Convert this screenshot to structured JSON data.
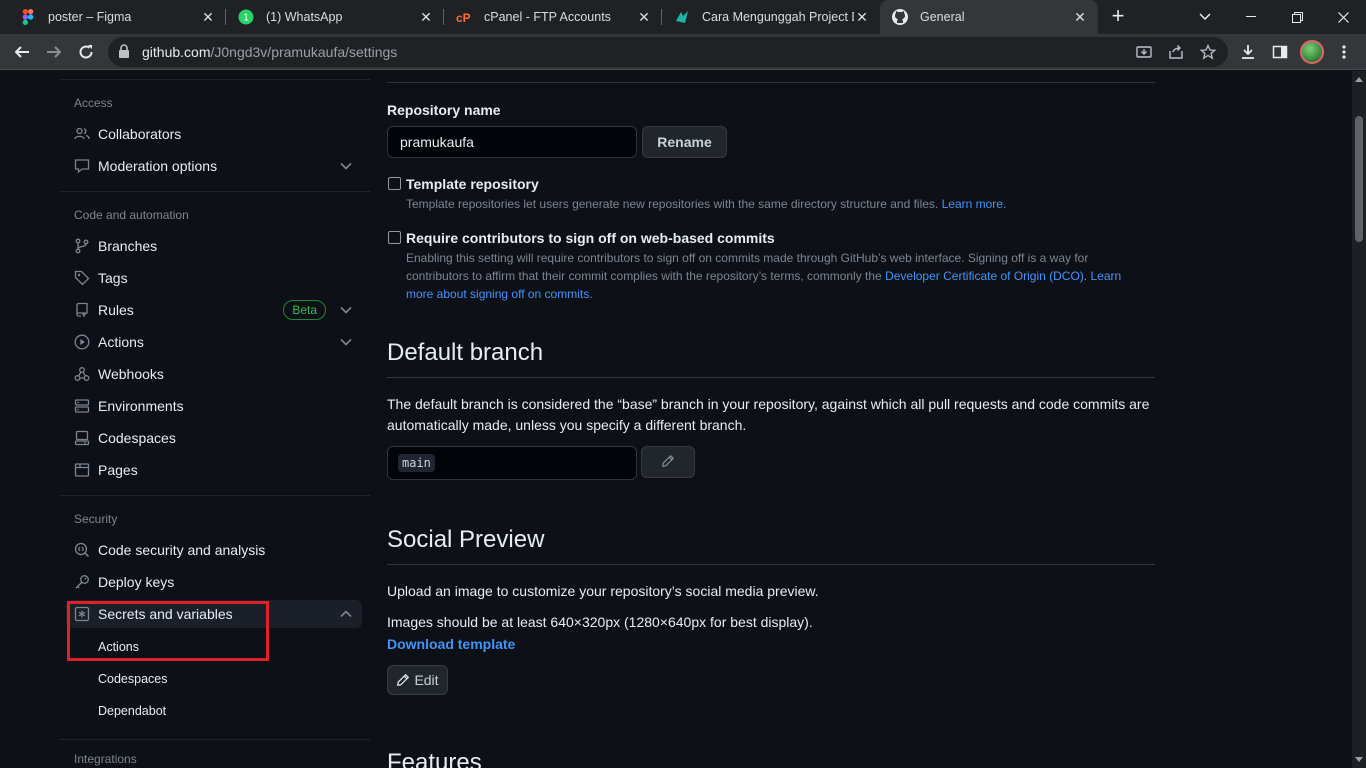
{
  "browser": {
    "tabs": [
      {
        "title": "poster – Figma",
        "icon": "figma-icon"
      },
      {
        "title": "(1) WhatsApp",
        "icon": "whatsapp-icon"
      },
      {
        "title": "cPanel - FTP Accounts",
        "icon": "cpanel-icon"
      },
      {
        "title": "Cara Mengunggah Project D",
        "icon": "site-icon"
      },
      {
        "title": "General",
        "icon": "github-icon"
      }
    ],
    "url_host": "github.com",
    "url_path": "/J0ngd3v/pramukaufa/settings"
  },
  "sidebar": {
    "access_title": "Access",
    "collaborators": "Collaborators",
    "moderation": "Moderation options",
    "code_title": "Code and automation",
    "branches": "Branches",
    "tags": "Tags",
    "rules": "Rules",
    "beta": "Beta",
    "actions": "Actions",
    "webhooks": "Webhooks",
    "environments": "Environments",
    "codespaces": "Codespaces",
    "pages": "Pages",
    "security_title": "Security",
    "code_security": "Code security and analysis",
    "deploy_keys": "Deploy keys",
    "secrets": "Secrets and variables",
    "sub_actions": "Actions",
    "sub_codespaces": "Codespaces",
    "sub_dependabot": "Dependabot",
    "integrations_title": "Integrations"
  },
  "main": {
    "repo_name_label": "Repository name",
    "repo_name_value": "pramukaufa",
    "rename_button": "Rename",
    "template_label": "Template repository",
    "template_note": "Template repositories let users generate new repositories with the same directory structure and files.",
    "learn_more": "Learn more.",
    "signoff_label": "Require contributors to sign off on web-based commits",
    "signoff_note_1": "Enabling this setting will require contributors to sign off on commits made through GitHub’s web interface. Signing off is a way for contributors to affirm that their commit complies with the repository’s terms, commonly the",
    "signoff_link_dco": "Developer Certificate of Origin (DCO).",
    "signoff_link_learn": "Learn more about signing off on commits.",
    "default_branch_title": "Default branch",
    "default_branch_desc": "The default branch is considered the “base” branch in your repository, against which all pull requests and code commits are automatically made, unless you specify a different branch.",
    "branch_value": "main",
    "social_title": "Social Preview",
    "social_desc": "Upload an image to customize your repository’s social media preview.",
    "social_size": "Images should be at least 640×320px (1280×640px for best display).",
    "download_template": "Download template",
    "edit_button": "Edit",
    "features_title": "Features"
  }
}
